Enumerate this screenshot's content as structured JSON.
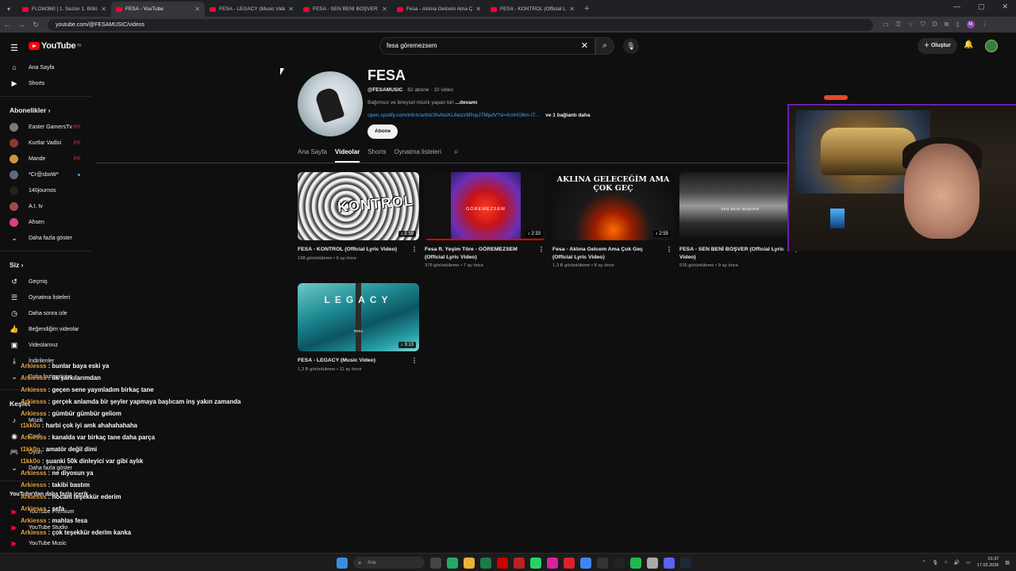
{
  "browser": {
    "tabs": [
      {
        "title": "FLOW360 | 1. Sezon 1. Bölüm |",
        "active": false
      },
      {
        "title": "FESA - YouTube",
        "active": true
      },
      {
        "title": "FESA - LEGACY (Music Video) -",
        "active": false
      },
      {
        "title": "FESA - SEN BENİ BOŞVER (Offi",
        "active": false
      },
      {
        "title": "Fesa - Aklına Gelcem Ama Çok",
        "active": false
      },
      {
        "title": "FESA - KONTROL (Official Lyric",
        "active": false
      }
    ],
    "url": "youtube.com/@FESAMUSIC/videos",
    "profile_letter": "M"
  },
  "header": {
    "logo": "YouTube",
    "country": "TR",
    "search_value": "fesa göremezsem",
    "create_label": "Oluştur"
  },
  "sidebar": {
    "main": [
      {
        "label": "Ana Sayfa",
        "icon": "home-icon"
      },
      {
        "label": "Shorts",
        "icon": "shorts-icon"
      }
    ],
    "subs_header": "Abonelikler",
    "subscriptions": [
      {
        "label": "Easter GamersTv",
        "badge": "live",
        "color": "#7a7a7a"
      },
      {
        "label": "Kurtlar Vadisi",
        "badge": "live",
        "color": "#8b3a2a"
      },
      {
        "label": "Mande",
        "badge": "live",
        "color": "#c49a3a"
      },
      {
        "label": "*Cr@sboW*",
        "badge": "dot",
        "color": "#5c6b80"
      },
      {
        "label": "140journos",
        "badge": "",
        "color": "#222222"
      },
      {
        "label": "A.I. tv",
        "badge": "",
        "color": "#a04a4a"
      },
      {
        "label": "Ahsen",
        "badge": "",
        "color": "#d8457a"
      }
    ],
    "more_label": "Daha fazla göster",
    "you_header": "Siz",
    "you_items": [
      {
        "label": "Geçmiş",
        "icon": "history-icon"
      },
      {
        "label": "Oynatma listeleri",
        "icon": "playlist-icon"
      },
      {
        "label": "Daha sonra izle",
        "icon": "clock-icon"
      },
      {
        "label": "Beğendiğim videolar",
        "icon": "like-icon"
      },
      {
        "label": "Videolarınız",
        "icon": "video-icon"
      },
      {
        "label": "İndirilenler",
        "icon": "download-icon"
      },
      {
        "label": "Daha fazla göster",
        "icon": "chevron-down-icon"
      }
    ],
    "explore_header": "Keşfet",
    "explore_items": [
      {
        "label": "Müzik",
        "icon": "music-icon"
      },
      {
        "label": "Canlı",
        "icon": "live-icon"
      },
      {
        "label": "Oyun",
        "icon": "game-icon"
      },
      {
        "label": "Daha fazla göster",
        "icon": "chevron-down-icon"
      }
    ],
    "more_from_header": "YouTube'dan daha fazla içerik",
    "more_from_items": [
      {
        "label": "YouTube Premium"
      },
      {
        "label": "YouTube Studio"
      },
      {
        "label": "YouTube Music"
      },
      {
        "label": "YouTube Kids"
      }
    ]
  },
  "channel": {
    "name": "FESA",
    "handle": "@FESAMUSIC",
    "subscribers": "62 abone",
    "videos_count": "10 video",
    "description": "Bağımsız ve bireysel müzik yapan biri",
    "more": "...devamı",
    "link": "open.spotify.com/intl-tr/artist/3hAbcKL6eizz9RvpJ7MpdV?si=KmHO6m-IT...",
    "more_links": "ve 1 bağlantı daha",
    "subscribe": "Abone ol",
    "tabs": [
      "Ana Sayfa",
      "Videolar",
      "Shorts",
      "Oynatma listeleri"
    ]
  },
  "videos": [
    {
      "title": "FESA - KONTROL (Official Lyric Video)",
      "views": "198 görüntüleme",
      "age": "6 ay önce",
      "duration": "1:59",
      "thumb_text": "KONTROL",
      "progress": 0
    },
    {
      "title": "Fesa ft. Yeşim Töre - GÖREMEZSEM (Official Lyric Video)",
      "views": "376 görüntüleme",
      "age": "7 ay önce",
      "duration": "2:33",
      "thumb_text": "GÖREMEZSEM",
      "progress": 1.0
    },
    {
      "title": "Fesa - Aklına Gelcem Ama Çok Geç (Official Lyric Video)",
      "views": "1,3 B görüntüleme",
      "age": "8 ay önce",
      "duration": "2:55",
      "thumb_text": "AKLINA GELECEĞİM AMA ÇOK GEÇ",
      "progress": 0
    },
    {
      "title": "FESA - SEN BENİ BOŞVER (Official Lyric Video)",
      "views": "535 görüntüleme",
      "age": "9 ay önce",
      "duration": "",
      "thumb_text": "SEN BENİ BOŞVER",
      "progress": 0
    },
    {
      "title": "FESA - LEGACY (Music Video)",
      "views": "1,3 B görüntüleme",
      "age": "11 ay önce",
      "duration": "3:13",
      "thumb_text": "LEGACY",
      "thumb_text2": "FESA",
      "progress": 0
    }
  ],
  "chat": [
    {
      "user": "Arkiesss",
      "msg": "bunlar baya eski ya"
    },
    {
      "user": "Arkiesss",
      "msg": "ilk şarkılarımdan"
    },
    {
      "user": "Arkiesss",
      "msg": "geçen sene yayınladım birkaç tane"
    },
    {
      "user": "Arkiesss",
      "msg": "gerçek anlamda bir şeyler yapmaya başlıcam inş yakın zamanda"
    },
    {
      "user": "Arkiesss",
      "msg": "gümbür gümbür geliom"
    },
    {
      "user": "t1kk0o",
      "msg": "harbi çok iyi amk ahahahahaha"
    },
    {
      "user": "Arkiesss",
      "msg": "kanalda var birkaç tane daha parça"
    },
    {
      "user": "t1kk0o",
      "msg": "amatör değil dimi"
    },
    {
      "user": "t1kk0o",
      "msg": "şuanki 50k dinleyici var gibi aylık"
    },
    {
      "user": "Arkiesss",
      "msg": "ne diyosun ya"
    },
    {
      "user": "Arkiesss",
      "msg": "takibi bastım"
    },
    {
      "user": "Arkiesss",
      "msg": "hocam teşekkür ederim"
    },
    {
      "user": "Arkiesss",
      "msg": "sefa"
    },
    {
      "user": "Arkiesss",
      "msg": "mahlas fesa"
    },
    {
      "user": "Arkiesss",
      "msg": "çok teşekkür ederim kanka"
    }
  ],
  "taskbar": {
    "search_label": "Ara",
    "time": "01:37",
    "date": "17.02.2026"
  }
}
